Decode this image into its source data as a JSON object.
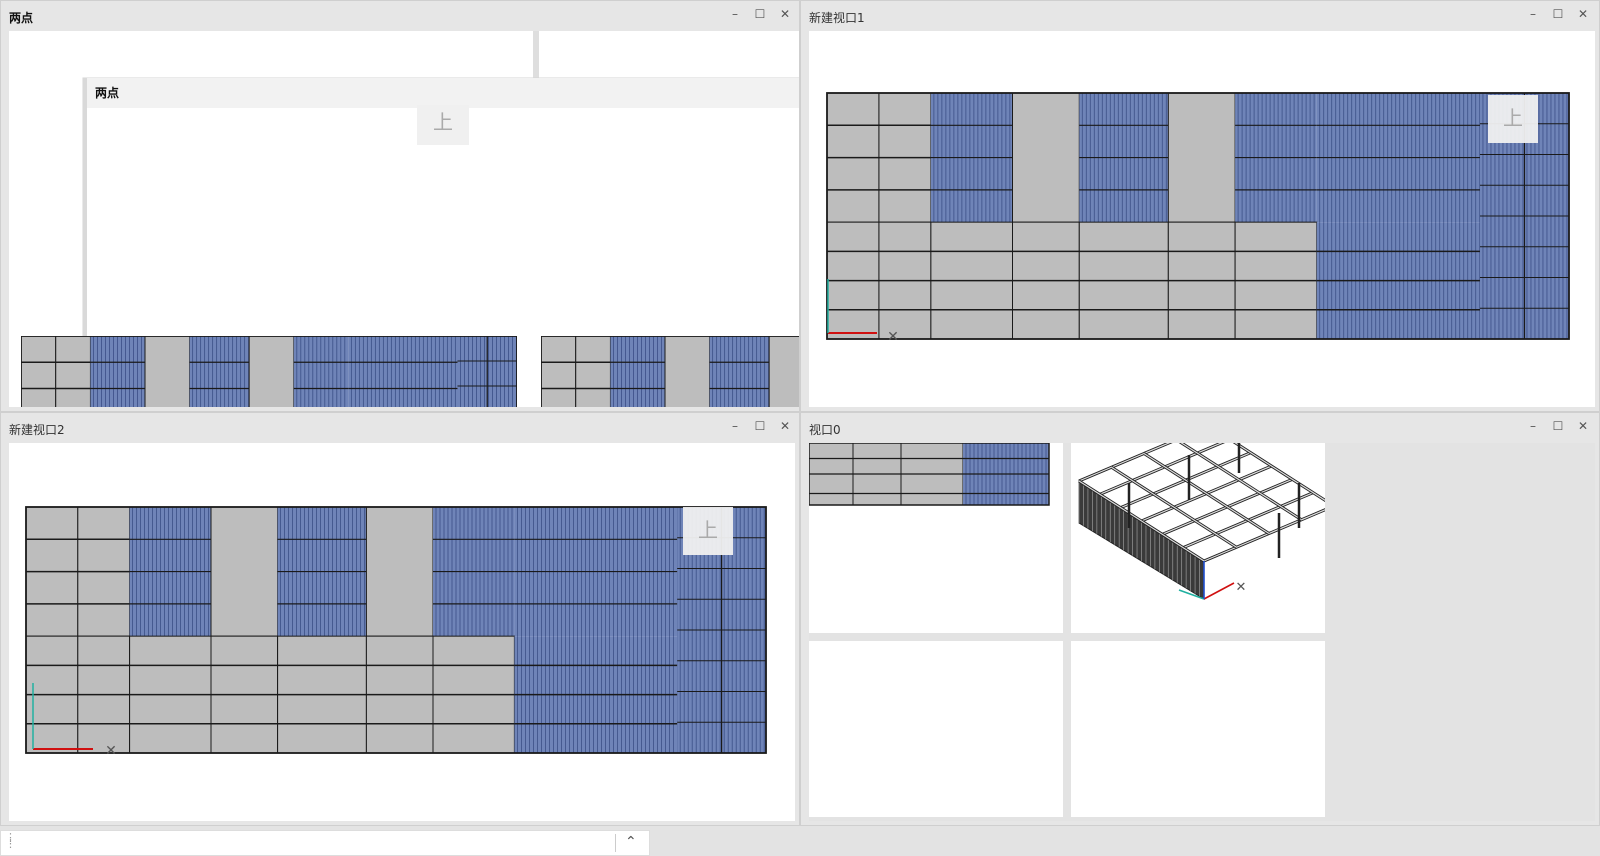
{
  "panes": {
    "top_left": {
      "title": "两点",
      "inner_title": "两点",
      "view_label": "上"
    },
    "top_right": {
      "title": "新建视口1",
      "view_label": "上"
    },
    "bottom_left": {
      "title": "新建视口2",
      "view_label": "上"
    },
    "bottom_right": {
      "title": "视口0"
    }
  },
  "controls": {
    "minimize": "–",
    "maximize": "☐",
    "close": "✕"
  },
  "colors": {
    "panel_gray": "#bdbdbd",
    "solar_blue": "#6f84b8",
    "axis_x": "#d01010",
    "axis_y": "#20b0a0",
    "frame": "#1a1a1a"
  },
  "command_bar": {
    "expand_icon": "chevron-up-icon",
    "expand_glyph": "⌃"
  }
}
